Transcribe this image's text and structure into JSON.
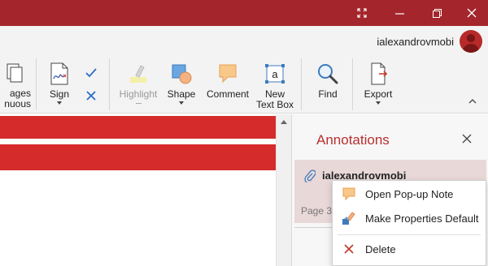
{
  "window": {
    "controls": [
      "expand",
      "minimize",
      "maximize",
      "close"
    ],
    "titlebar_color": "#a4262c"
  },
  "account": {
    "username": "ialexandrovmobi"
  },
  "ribbon": {
    "pages_label_line1": "ages",
    "pages_label_line2": "nuous",
    "sign_label": "Sign",
    "highlight_label": "Highlight",
    "shape_label": "Shape",
    "comment_label": "Comment",
    "textbox_label_line1": "New",
    "textbox_label_line2": "Text Box",
    "textbox_glyph": "a",
    "find_label": "Find",
    "export_label": "Export",
    "highlight_enabled": false
  },
  "document": {
    "band_color": "#d52b2b"
  },
  "annotations_panel": {
    "title": "Annotations",
    "title_color": "#b7302f",
    "item": {
      "author": "ialexandrovmobi",
      "page": "Page 3",
      "selected_bg": "#e9d8d8"
    }
  },
  "context_menu": {
    "items": [
      {
        "label": "Open Pop-up Note",
        "icon": "note-icon"
      },
      {
        "label": "Make Properties Default",
        "icon": "properties-brush-icon"
      },
      {
        "label": "Delete",
        "icon": "delete-x-icon"
      }
    ]
  },
  "icons": {
    "accent": "#c0392b",
    "note_fill": "#f7c88a",
    "note_stroke": "#e8a054"
  }
}
